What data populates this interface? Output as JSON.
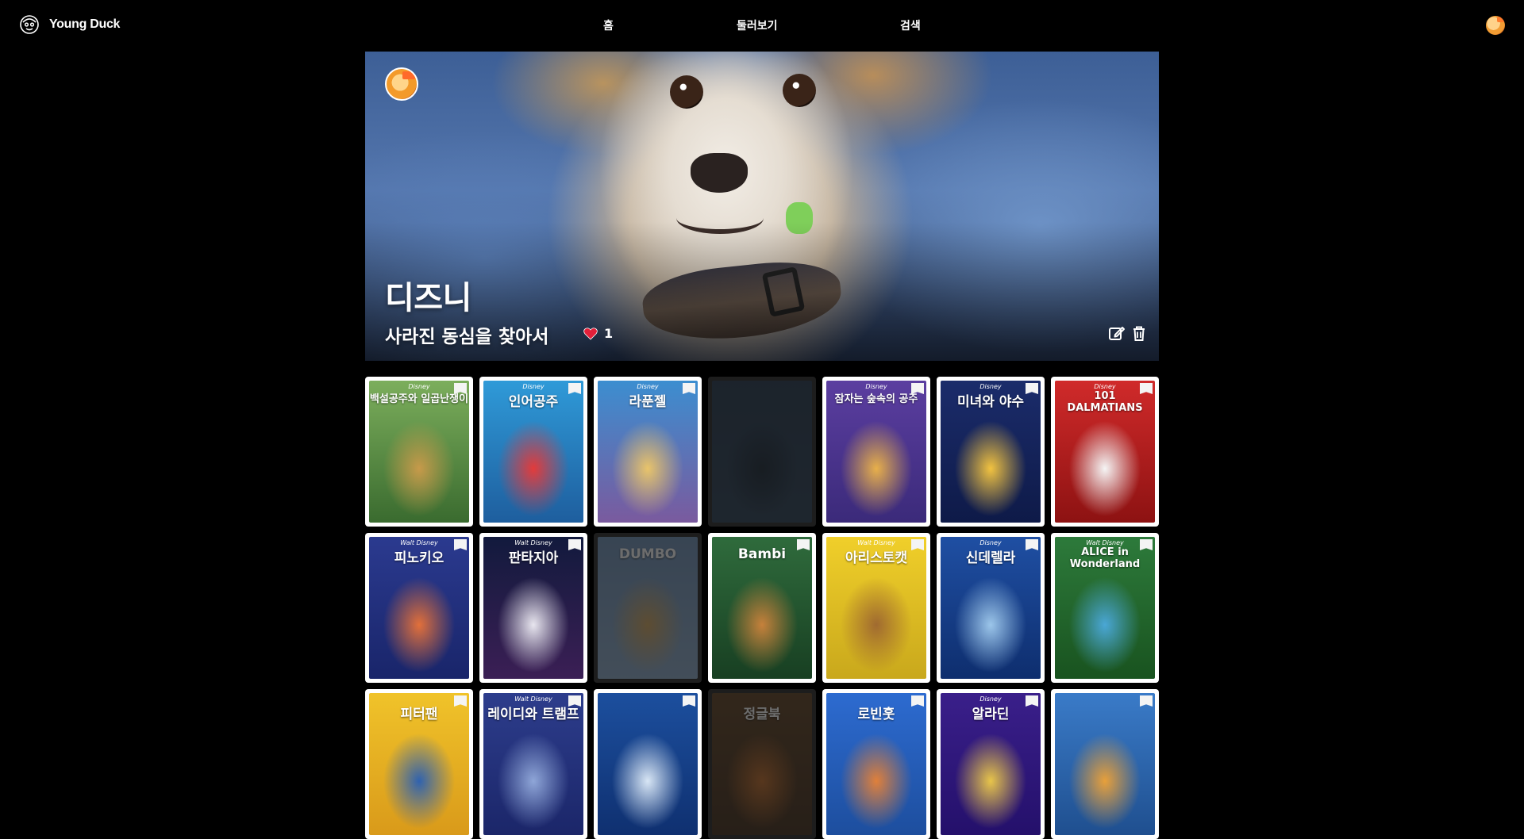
{
  "header": {
    "brand_name": "Young Duck",
    "nav": {
      "home": "홈",
      "browse": "둘러보기",
      "search": "검색"
    }
  },
  "hero": {
    "title": "디즈니",
    "subtitle": "사라진 동심을 찾아서",
    "like_count": "1"
  },
  "posters": [
    {
      "title": "백설공주와 일곱난쟁이",
      "brand": "Disney",
      "colors": [
        "#7cae5c",
        "#c79a4a",
        "#3a6b2f"
      ],
      "dim": false
    },
    {
      "title": "인어공주",
      "brand": "Disney",
      "colors": [
        "#2f9ad8",
        "#e33b3b",
        "#1e5e9e"
      ],
      "dim": false
    },
    {
      "title": "라푼젤",
      "brand": "Disney",
      "colors": [
        "#3c8ed0",
        "#e9c46a",
        "#7a5a9e"
      ],
      "dim": false
    },
    {
      "title": "",
      "brand": "",
      "colors": [
        "#1b3048",
        "#0f1d2c",
        "#22384f"
      ],
      "dim": true
    },
    {
      "title": "잠자는 숲속의 공주",
      "brand": "Disney",
      "colors": [
        "#5b3ea0",
        "#e8b04a",
        "#3b2a7a"
      ],
      "dim": false
    },
    {
      "title": "미녀와 야수",
      "brand": "Disney",
      "colors": [
        "#1b2c6b",
        "#f2c340",
        "#0e1a48"
      ],
      "dim": false
    },
    {
      "title": "101 DALMATIANS",
      "brand": "Disney",
      "colors": [
        "#d02a2a",
        "#f5f5f5",
        "#8d1212"
      ],
      "dim": false
    },
    {
      "title": "피노키오",
      "brand": "Walt Disney",
      "colors": [
        "#2b3a8f",
        "#e2703a",
        "#19256a"
      ],
      "dim": false
    },
    {
      "title": "판타지아",
      "brand": "Walt Disney",
      "colors": [
        "#121a3d",
        "#e8e6ef",
        "#3b1f55"
      ],
      "dim": false
    },
    {
      "title": "DUMBO",
      "brand": "",
      "colors": [
        "#6b8fb8",
        "#d4a65a",
        "#8aa9c9"
      ],
      "dim": true
    },
    {
      "title": "Bambi",
      "brand": "",
      "colors": [
        "#2f6b3c",
        "#c6813b",
        "#183f22"
      ],
      "dim": false
    },
    {
      "title": "아리스토캣",
      "brand": "Walt Disney",
      "colors": [
        "#f0cf2a",
        "#a06a30",
        "#c9a81c"
      ],
      "dim": false
    },
    {
      "title": "신데렐라",
      "brand": "Disney",
      "colors": [
        "#1f4fa3",
        "#9cc6ea",
        "#0e2e6e"
      ],
      "dim": false
    },
    {
      "title": "ALICE in Wonderland",
      "brand": "Walt Disney",
      "colors": [
        "#2d7a3b",
        "#4aa7d6",
        "#19531f"
      ],
      "dim": false
    },
    {
      "title": "피터팬",
      "brand": "",
      "colors": [
        "#f0c32a",
        "#2f62b0",
        "#d99a1a"
      ],
      "dim": false
    },
    {
      "title": "레이디와 트램프",
      "brand": "Walt Disney",
      "colors": [
        "#2d3d8c",
        "#8fa6d8",
        "#1b2669"
      ],
      "dim": false
    },
    {
      "title": "",
      "brand": "",
      "colors": [
        "#1c4f9e",
        "#d8e6f5",
        "#0f3070"
      ],
      "dim": false
    },
    {
      "title": "정글북",
      "brand": "",
      "colors": [
        "#5a3a1a",
        "#c2671f",
        "#3b2410"
      ],
      "dim": true
    },
    {
      "title": "로빈훗",
      "brand": "",
      "colors": [
        "#2d6bd0",
        "#e0803a",
        "#1d4e9e"
      ],
      "dim": false
    },
    {
      "title": "알라딘",
      "brand": "Disney",
      "colors": [
        "#3a1f8a",
        "#e8c54a",
        "#24106b"
      ],
      "dim": false
    },
    {
      "title": "",
      "brand": "",
      "colors": [
        "#3a7bc8",
        "#e8a03a",
        "#1f4f8f"
      ],
      "dim": false
    }
  ]
}
